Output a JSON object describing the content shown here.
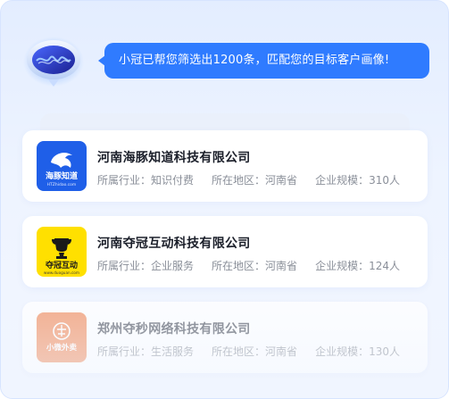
{
  "bubble": {
    "text": "小冠已帮您筛选出1200条，匹配您的目标客户画像!"
  },
  "labels": {
    "industry": "所属行业：",
    "region": "所在地区：",
    "scale": "企业规模："
  },
  "companies": [
    {
      "name": "河南海豚知道科技有限公司",
      "industry": "知识付费",
      "region": "河南省",
      "scale": "310人",
      "logo_text": "海豚知道",
      "logo_subtext": "HTZhidao.com",
      "logo_color": "#1f5fe8"
    },
    {
      "name": "河南夺冠互动科技有限公司",
      "industry": "企业服务",
      "region": "河南省",
      "scale": "124人",
      "logo_text": "夺冠互动",
      "logo_subtext": "www.duoguan.com",
      "logo_color": "#ffe000"
    },
    {
      "name": "郑州夺秒网络科技有限公司",
      "industry": "生活服务",
      "region": "河南省",
      "scale": "130人",
      "logo_text": "小微外卖",
      "logo_subtext": "",
      "logo_color": "#f08a4b"
    }
  ],
  "colors": {
    "accent": "#2f7bff",
    "panel_bg": "#eaf1ff"
  }
}
